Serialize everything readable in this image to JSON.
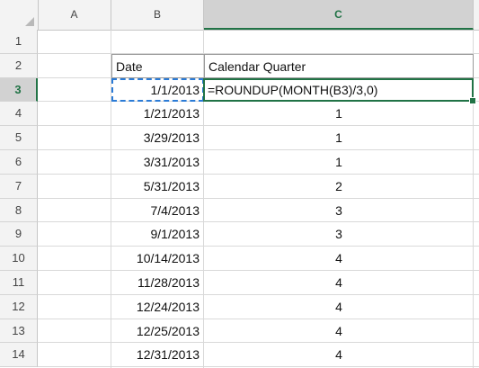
{
  "columns": [
    "A",
    "B",
    "C"
  ],
  "rows": [
    "1",
    "2",
    "3",
    "4",
    "5",
    "6",
    "7",
    "8",
    "9",
    "10",
    "11",
    "12",
    "13",
    "14"
  ],
  "headers": {
    "date": "Date",
    "quarter": "Calendar Quarter"
  },
  "active_cell": {
    "formula": "=ROUNDUP(MONTH(B3)/3,0)",
    "date": "1/1/2013"
  },
  "data": [
    {
      "date": "1/21/2013",
      "quarter": "1"
    },
    {
      "date": "3/29/2013",
      "quarter": "1"
    },
    {
      "date": "3/31/2013",
      "quarter": "1"
    },
    {
      "date": "5/31/2013",
      "quarter": "2"
    },
    {
      "date": "7/4/2013",
      "quarter": "3"
    },
    {
      "date": "9/1/2013",
      "quarter": "3"
    },
    {
      "date": "10/14/2013",
      "quarter": "4"
    },
    {
      "date": "11/28/2013",
      "quarter": "4"
    },
    {
      "date": "12/24/2013",
      "quarter": "4"
    },
    {
      "date": "12/25/2013",
      "quarter": "4"
    },
    {
      "date": "12/31/2013",
      "quarter": "4"
    }
  ],
  "colors": {
    "accent": "#217346",
    "marquee": "#2b7bd6"
  }
}
